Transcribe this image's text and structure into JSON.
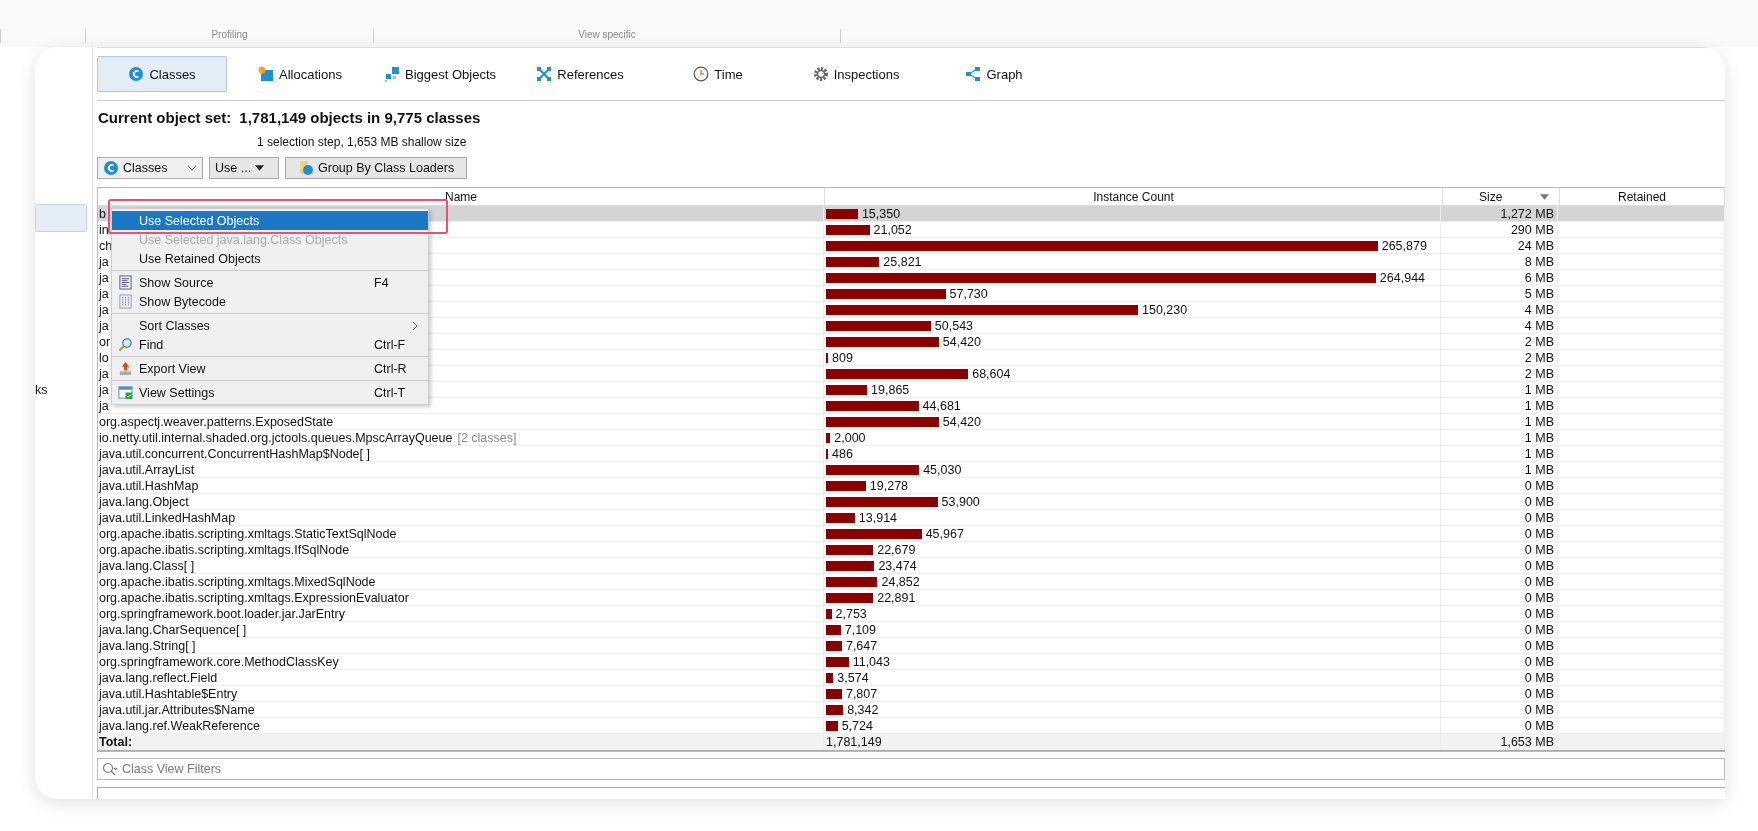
{
  "header_groups": [
    {
      "label": "Profiling"
    },
    {
      "label": "View specific"
    }
  ],
  "sidebar": {
    "items": [
      {
        "selected": true
      },
      {
        "label": "ks",
        "selected": false
      }
    ]
  },
  "tabs": [
    {
      "label": "Classes",
      "selected": true
    },
    {
      "label": "Allocations",
      "selected": false
    },
    {
      "label": "Biggest Objects",
      "selected": false
    },
    {
      "label": "References",
      "selected": false
    },
    {
      "label": "Time",
      "selected": false
    },
    {
      "label": "Inspections",
      "selected": false
    },
    {
      "label": "Graph",
      "selected": false
    }
  ],
  "object_set": {
    "label": "Current object set:",
    "value": "1,781,149 objects in 9,775 classes",
    "detail": "1 selection step, 1,653 MB shallow size"
  },
  "controls": {
    "view_select": "Classes",
    "use_button": "Use ...",
    "group_button": "Group By Class Loaders"
  },
  "table": {
    "columns": [
      {
        "label": "Name",
        "sorted": false
      },
      {
        "label": "Instance Count",
        "sorted": false
      },
      {
        "label": "Size",
        "sorted": true
      },
      {
        "label": "Retained",
        "sorted": false
      }
    ],
    "rows": [
      {
        "name": "b",
        "count": "15,350",
        "level": 0.052,
        "size": "1,272 MB",
        "selected": true
      },
      {
        "name": "in",
        "count": "21,052",
        "level": 0.071,
        "size": "290 MB",
        "selected": false
      },
      {
        "name": "ch",
        "count": "265,879",
        "level": 0.9,
        "size": "24 MB",
        "selected": false
      },
      {
        "name": "ja",
        "count": "25,821",
        "level": 0.087,
        "size": "8 MB",
        "selected": false
      },
      {
        "name": "ja",
        "count": "264,944",
        "level": 0.897,
        "size": "6 MB",
        "selected": false
      },
      {
        "name": "ja",
        "count": "57,730",
        "level": 0.195,
        "size": "5 MB",
        "selected": false
      },
      {
        "name": "ja",
        "count": "150,230",
        "level": 0.509,
        "size": "4 MB",
        "selected": false
      },
      {
        "name": "ja",
        "count": "50,543",
        "level": 0.171,
        "size": "4 MB",
        "selected": false
      },
      {
        "name": "or",
        "count": "54,420",
        "level": 0.184,
        "size": "2 MB",
        "selected": false
      },
      {
        "name": "lo",
        "count": "809",
        "level": 0.003,
        "size": "2 MB",
        "selected": false
      },
      {
        "name": "ja",
        "count": "68,604",
        "level": 0.232,
        "size": "2 MB",
        "selected": false
      },
      {
        "name": "ja",
        "count": "19,865",
        "level": 0.067,
        "size": "1 MB",
        "selected": false
      },
      {
        "name": "ja",
        "count": "44,681",
        "level": 0.151,
        "size": "1 MB",
        "selected": false
      },
      {
        "name": "org.aspectj.weaver.patterns.ExposedState",
        "count": "54,420",
        "level": 0.184,
        "size": "1 MB",
        "selected": false
      },
      {
        "name": "io.netty.util.internal.shaded.org.jctools.queues.MpscArrayQueue",
        "note": "[2 classes]",
        "count": "2,000",
        "level": 0.007,
        "size": "1 MB",
        "selected": false
      },
      {
        "name": "java.util.concurrent.ConcurrentHashMap$Node[ ]",
        "count": "486",
        "level": 0.002,
        "size": "1 MB",
        "selected": false
      },
      {
        "name": "java.util.ArrayList",
        "count": "45,030",
        "level": 0.152,
        "size": "1 MB",
        "selected": false
      },
      {
        "name": "java.util.HashMap",
        "count": "19,278",
        "level": 0.065,
        "size": "0 MB",
        "selected": false
      },
      {
        "name": "java.lang.Object",
        "count": "53,900",
        "level": 0.182,
        "size": "0 MB",
        "selected": false
      },
      {
        "name": "java.util.LinkedHashMap",
        "count": "13,914",
        "level": 0.047,
        "size": "0 MB",
        "selected": false
      },
      {
        "name": "org.apache.ibatis.scripting.xmltags.StaticTextSqlNode",
        "count": "45,967",
        "level": 0.156,
        "size": "0 MB",
        "selected": false
      },
      {
        "name": "org.apache.ibatis.scripting.xmltags.IfSqlNode",
        "count": "22,679",
        "level": 0.077,
        "size": "0 MB",
        "selected": false
      },
      {
        "name": "java.lang.Class[ ]",
        "count": "23,474",
        "level": 0.079,
        "size": "0 MB",
        "selected": false
      },
      {
        "name": "org.apache.ibatis.scripting.xmltags.MixedSqlNode",
        "count": "24,852",
        "level": 0.084,
        "size": "0 MB",
        "selected": false
      },
      {
        "name": "org.apache.ibatis.scripting.xmltags.ExpressionEvaluator",
        "count": "22,891",
        "level": 0.077,
        "size": "0 MB",
        "selected": false
      },
      {
        "name": "org.springframework.boot.loader.jar.JarEntry",
        "count": "2,753",
        "level": 0.009,
        "size": "0 MB",
        "selected": false
      },
      {
        "name": "java.lang.CharSequence[ ]",
        "count": "7,109",
        "level": 0.024,
        "size": "0 MB",
        "selected": false
      },
      {
        "name": "java.lang.String[ ]",
        "count": "7,647",
        "level": 0.026,
        "size": "0 MB",
        "selected": false
      },
      {
        "name": "org.springframework.core.MethodClassKey",
        "count": "11,043",
        "level": 0.037,
        "size": "0 MB",
        "selected": false
      },
      {
        "name": "java.lang.reflect.Field",
        "count": "3,574",
        "level": 0.012,
        "size": "0 MB",
        "selected": false
      },
      {
        "name": "java.util.Hashtable$Entry",
        "count": "7,807",
        "level": 0.026,
        "size": "0 MB",
        "selected": false
      },
      {
        "name": "java.util.jar.Attributes$Name",
        "count": "8,342",
        "level": 0.028,
        "size": "0 MB",
        "selected": false
      },
      {
        "name": "java.lang.ref.WeakReference",
        "count": "5,724",
        "level": 0.019,
        "size": "0 MB",
        "selected": false
      }
    ],
    "total": {
      "label": "Total:",
      "count": "1,781,149",
      "size": "1,653 MB"
    }
  },
  "filter": {
    "placeholder": "Class View Filters"
  },
  "context_menu": [
    {
      "kind": "item",
      "label": "Use Selected Objects",
      "selected": true,
      "disabled": false,
      "highlighted": true
    },
    {
      "kind": "item",
      "label": "Use Selected java.lang.Class Objects",
      "selected": false,
      "disabled": true,
      "highlighted": false
    },
    {
      "kind": "item",
      "label": "Use Retained Objects",
      "selected": false,
      "disabled": false,
      "highlighted": false
    },
    {
      "kind": "separator"
    },
    {
      "kind": "item",
      "label": "Show Source",
      "shortcut": "F4",
      "selected": false,
      "disabled": false,
      "highlighted": false
    },
    {
      "kind": "item",
      "label": "Show Bytecode",
      "selected": false,
      "disabled": false,
      "highlighted": false
    },
    {
      "kind": "separator"
    },
    {
      "kind": "submenu",
      "label": "Sort Classes",
      "selected": false,
      "disabled": false,
      "highlighted": false
    },
    {
      "kind": "item",
      "label": "Find",
      "shortcut": "Ctrl-F",
      "selected": false,
      "disabled": false,
      "highlighted": false
    },
    {
      "kind": "separator"
    },
    {
      "kind": "item",
      "label": "Export View",
      "shortcut": "Ctrl-R",
      "selected": false,
      "disabled": false,
      "highlighted": false
    },
    {
      "kind": "separator"
    },
    {
      "kind": "item",
      "label": "View Settings",
      "shortcut": "Ctrl-T",
      "selected": false,
      "disabled": false,
      "highlighted": false
    }
  ]
}
